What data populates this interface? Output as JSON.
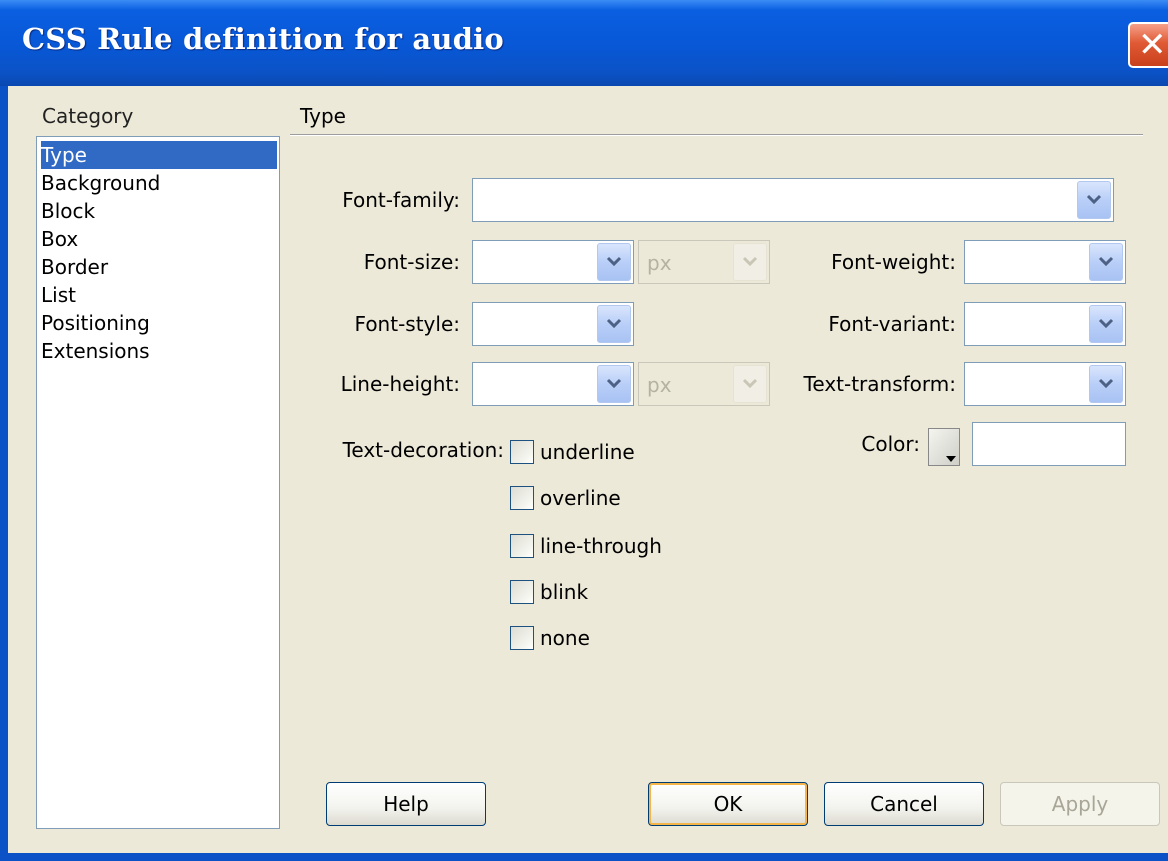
{
  "window": {
    "title": "CSS Rule definition for audio",
    "close_glyph": "✕"
  },
  "category": {
    "label": "Category",
    "items": [
      "Type",
      "Background",
      "Block",
      "Box",
      "Border",
      "List",
      "Positioning",
      "Extensions"
    ],
    "selected": "Type"
  },
  "panel": {
    "heading": "Type",
    "font_family": {
      "label": "Font-family:",
      "value": ""
    },
    "font_size": {
      "label": "Font-size:",
      "value": "",
      "unit": "px"
    },
    "font_weight": {
      "label": "Font-weight:",
      "value": ""
    },
    "font_style": {
      "label": "Font-style:",
      "value": ""
    },
    "font_variant": {
      "label": "Font-variant:",
      "value": ""
    },
    "line_height": {
      "label": "Line-height:",
      "value": "",
      "unit": "px"
    },
    "text_transform": {
      "label": "Text-transform:",
      "value": ""
    },
    "text_decoration": {
      "label": "Text-decoration:",
      "options": [
        {
          "label": "underline",
          "checked": false
        },
        {
          "label": "overline",
          "checked": false
        },
        {
          "label": "line-through",
          "checked": false
        },
        {
          "label": "blink",
          "checked": false
        },
        {
          "label": "none",
          "checked": false
        }
      ]
    },
    "color": {
      "label": "Color:",
      "value": ""
    }
  },
  "buttons": {
    "help": "Help",
    "ok": "OK",
    "cancel": "Cancel",
    "apply": "Apply"
  },
  "colors": {
    "title_bar": "#0858d8",
    "selection": "#316ac5",
    "dialog_bg": "#ece9d8"
  }
}
